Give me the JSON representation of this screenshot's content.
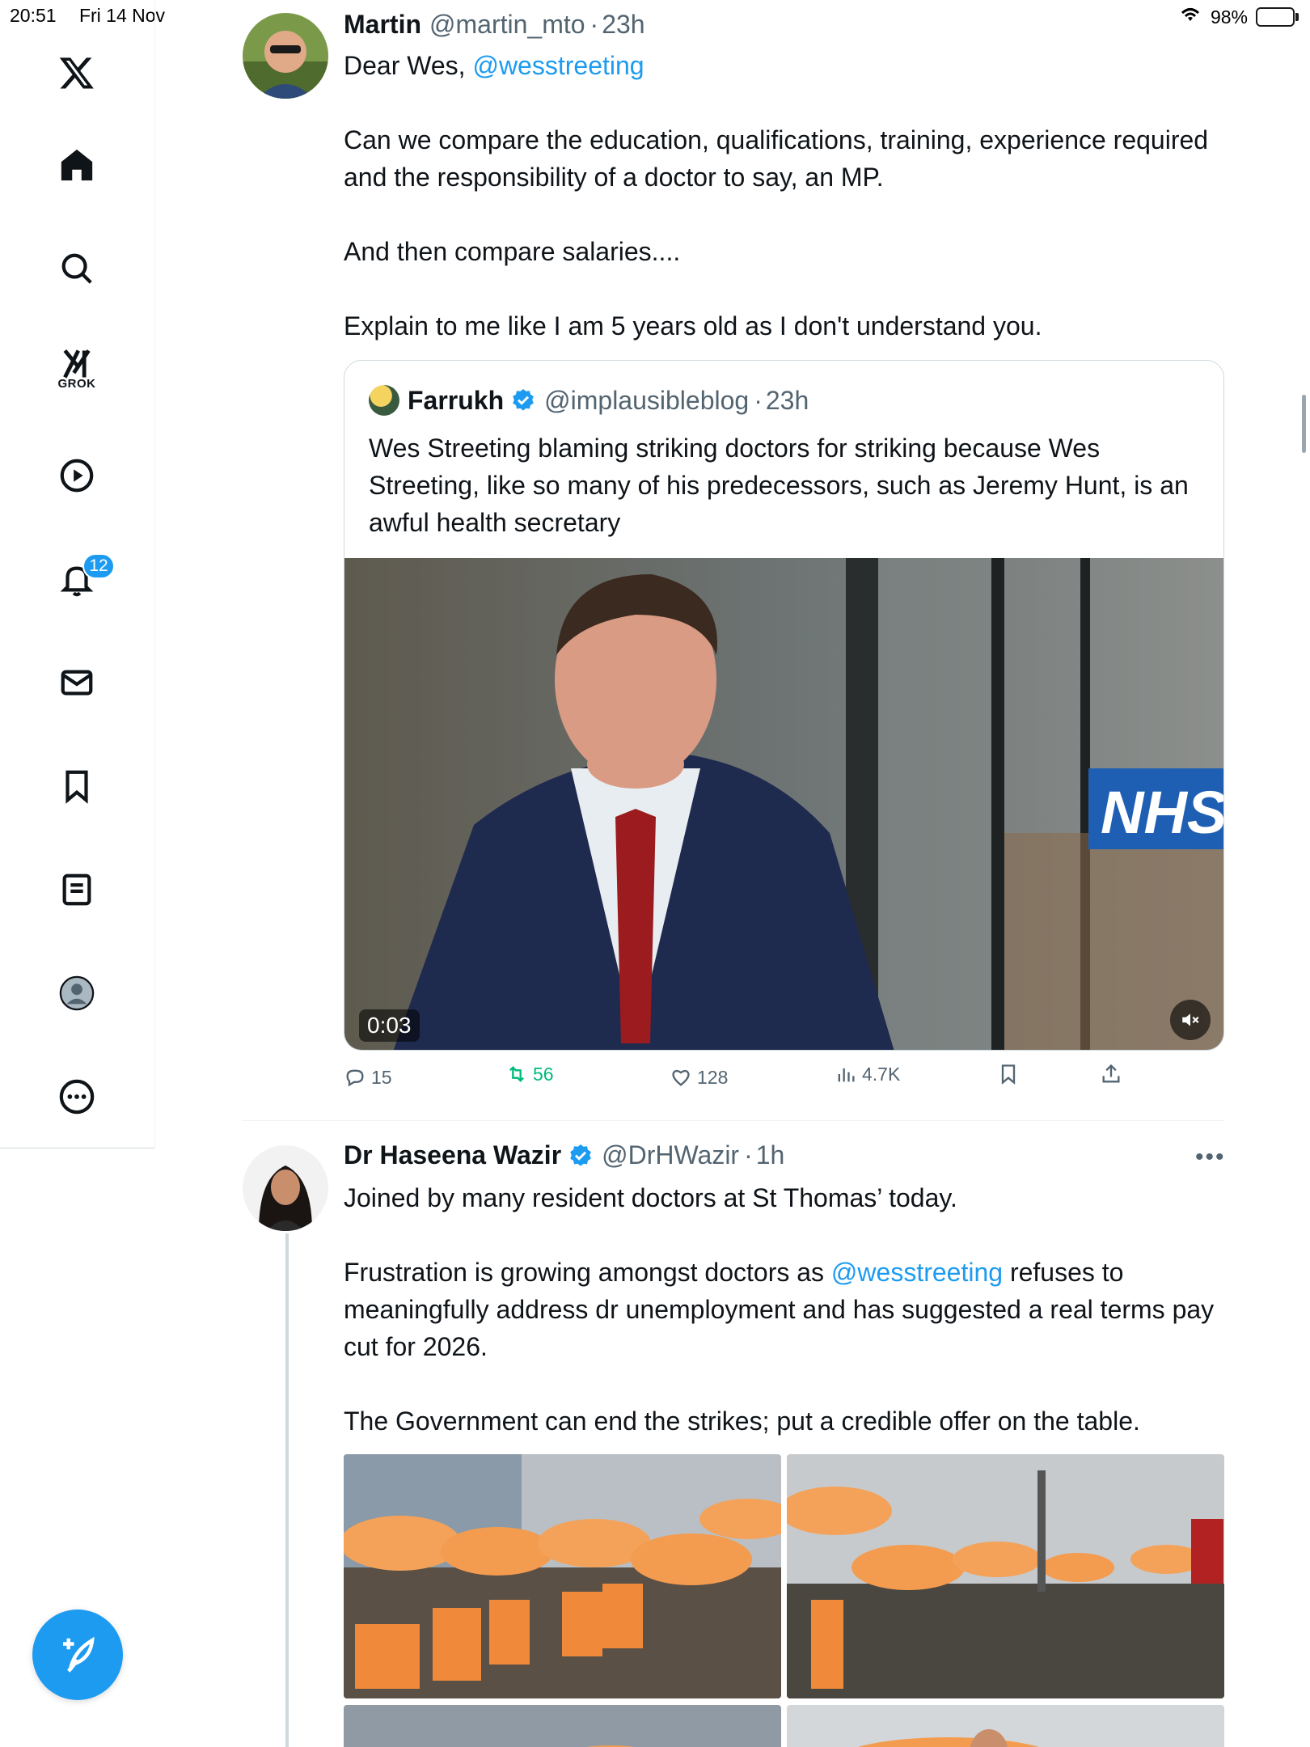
{
  "status_bar": {
    "time": "20:51",
    "date": "Fri 14 Nov",
    "battery": "98%",
    "battery_level": 0.98
  },
  "sidebar": {
    "grok_label": "GROK",
    "notifications_badge": "12"
  },
  "tweet1": {
    "name": "Martin",
    "handle": "@martin_mto",
    "time": "23h",
    "greeting_prefix": "Dear Wes, ",
    "greeting_mention": "@wesstreeting",
    "para1": "Can we compare the education, qualifications, training, experience required and the responsibility of a doctor to say, an MP.",
    "para2": "And then compare salaries....",
    "para3": "Explain to me like I am 5 years old as I don't understand you.",
    "quote": {
      "name": "Farrukh",
      "handle": "@implausibleblog",
      "time": "23h",
      "text": "Wes Streeting blaming striking doctors for striking because Wes Streeting, like so many of his predecessors, such as Jeremy Hunt, is an awful health secretary",
      "video_time": "0:03",
      "video_sign": "NHS"
    },
    "actions": {
      "replies": "15",
      "reposts": "56",
      "likes": "128",
      "views": "4.7K"
    }
  },
  "tweet2": {
    "name": "Dr Haseena Wazir",
    "handle": "@DrHWazir",
    "time": "1h",
    "para1": "Joined by many resident doctors at St Thomas’ today.",
    "para2_prefix": "Frustration is growing amongst doctors as ",
    "para2_mention": "@wesstreeting",
    "para2_suffix": " refuses to meaningfully address dr unemployment and has suggested a real terms pay cut for 2026.",
    "para3": "The Government can end the strikes; put a credible offer on the table."
  },
  "colors": {
    "accent": "#1d9bf0",
    "repost": "#00ba7c",
    "muted": "#536471"
  }
}
